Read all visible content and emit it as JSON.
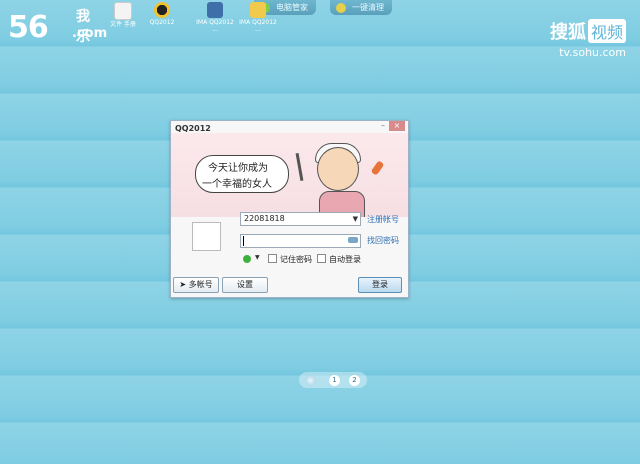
{
  "watermarks": {
    "site_56_number": "56",
    "site_56_cn": "我乐",
    "site_56_com": ".com",
    "sohu_brand": "搜狐",
    "sohu_badge": "视频",
    "sohu_url": "tv.sohu.com"
  },
  "top_tabs": [
    {
      "label": "电脑管家",
      "icon": "shield-icon"
    },
    {
      "label": "一键清理",
      "icon": "broom-icon"
    }
  ],
  "desktop_icons": [
    {
      "label": "文件 手册",
      "icon": "document-icon"
    },
    {
      "label": "QQ2012",
      "icon": "qq-penguin-icon"
    },
    {
      "label": "IMA QQ2012 …",
      "icon": "box-icon"
    },
    {
      "label": "IMA QQ2012 …",
      "icon": "folder-icon"
    }
  ],
  "qq_window": {
    "title": "QQ2012",
    "banner_line1": "今天让你成为",
    "banner_line2": "一个幸福的女人",
    "account_value": "22081818",
    "password_value": "",
    "register_link": "注册帐号",
    "find_password_link": "找回密码",
    "remember_password": "记住密码",
    "auto_login": "自动登录",
    "multi_account_button": "多帐号",
    "settings_button": "设置",
    "login_button": "登录"
  },
  "pager": {
    "page1": "1",
    "page2": "2"
  },
  "colors": {
    "desktop_bg": "#8fd3e6",
    "link": "#2d6eb5",
    "status_online": "#3db13d"
  }
}
